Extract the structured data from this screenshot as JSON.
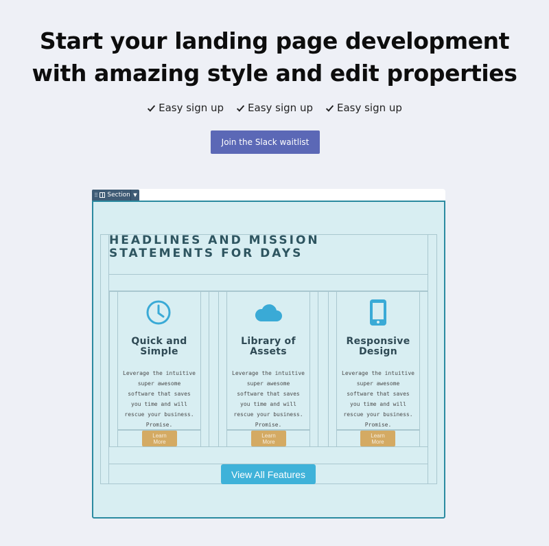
{
  "hero": {
    "title_line1": "Start your landing page development",
    "title_line2": "with amazing style and edit properties",
    "checks": [
      "Easy sign up",
      "Easy sign up",
      "Easy sign up"
    ],
    "cta_label": "Join the Slack waitlist"
  },
  "editor": {
    "section_tag_label": "Section",
    "headline": "HEADLINES AND MISSION\nSTATEMENTS FOR DAYS",
    "features": [
      {
        "icon": "clock-icon",
        "title": "Quick and\nSimple",
        "text": "Leverage the intuitive\nsuper awesome\nsoftware that saves\nyou time and will\nrescue your business.\nPromise.",
        "button": "Learn More"
      },
      {
        "icon": "cloud-icon",
        "title": "Library of\nAssets",
        "text": "Leverage the intuitive\nsuper awesome\nsoftware that saves\nyou time and will\nrescue your business.\nPromise.",
        "button": "Learn More"
      },
      {
        "icon": "mobile-phone-icon",
        "title": "Responsive\nDesign",
        "text": "Leverage the intuitive\nsuper awesome\nsoftware that saves\nyou time and will\nrescue your business.\nPromise.",
        "button": "Learn More"
      }
    ],
    "view_all_label": "View All Features"
  },
  "colors": {
    "page_bg": "#eef0f6",
    "cta": "#5b68b6",
    "section_bg": "#d8eef2",
    "section_border": "#2a8aa0",
    "icon_blue": "#3aaad6",
    "learn_more": "#d4aa63",
    "view_all": "#3fb2d9"
  }
}
